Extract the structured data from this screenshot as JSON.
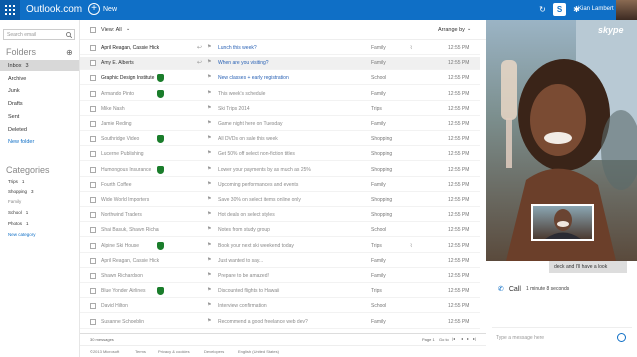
{
  "header": {
    "brand": "Outlook.com",
    "new_label": "New",
    "user_name": "Kian Lambert"
  },
  "sidebar": {
    "search_placeholder": "Search email",
    "folders_title": "Folders",
    "folders": [
      {
        "label": "Inbox",
        "count": "3"
      },
      {
        "label": "Archive",
        "count": ""
      },
      {
        "label": "Junk",
        "count": ""
      },
      {
        "label": "Drafts",
        "count": ""
      },
      {
        "label": "Sent",
        "count": ""
      },
      {
        "label": "Deleted",
        "count": ""
      }
    ],
    "new_folder": "New folder",
    "categories_title": "Categories",
    "categories": [
      {
        "label": "Trips",
        "count": "1"
      },
      {
        "label": "Shopping",
        "count": "3"
      },
      {
        "label": "Family",
        "count": ""
      },
      {
        "label": "School",
        "count": "1"
      },
      {
        "label": "Photos",
        "count": "1"
      }
    ],
    "new_category": "New category"
  },
  "list": {
    "view_label": "View: All",
    "arrange_label": "Arrange by",
    "rows": [
      {
        "sender": "April Reagan, Cassie Hicks",
        "subject": "Lunch this week?",
        "category": "Family",
        "date": "12:55 PM",
        "state": "unread"
      },
      {
        "sender": "Amy E. Alberts",
        "subject": "When are you visiting?",
        "category": "Family",
        "date": "12:55 PM",
        "state": "sel"
      },
      {
        "sender": "Graphic Design Institute",
        "subject": "New classes + early registration",
        "category": "School",
        "date": "12:55 PM",
        "state": "unread"
      },
      {
        "sender": "Armando Pinto",
        "subject": "This week's schedule",
        "category": "Family",
        "date": "12:55 PM",
        "state": "read"
      },
      {
        "sender": "Mike Nash",
        "subject": "Ski Trips 2014",
        "category": "Trips",
        "date": "12:55 PM",
        "state": "read"
      },
      {
        "sender": "Jamie Reding",
        "subject": "Game night here on Tuesday",
        "category": "Family",
        "date": "12:55 PM",
        "state": "read"
      },
      {
        "sender": "Southridge Video",
        "subject": "All DVDs on sale this week",
        "category": "Shopping",
        "date": "12:55 PM",
        "state": "read"
      },
      {
        "sender": "Lucerne Publishing",
        "subject": "Get 50% off select non-fiction titles",
        "category": "Shopping",
        "date": "12:55 PM",
        "state": "read"
      },
      {
        "sender": "Humongous Insurance",
        "subject": "Lower your payments by as much as 25%",
        "category": "Shopping",
        "date": "12:55 PM",
        "state": "read"
      },
      {
        "sender": "Fourth Coffee",
        "subject": "Upcoming performances and events",
        "category": "Family",
        "date": "12:55 PM",
        "state": "read"
      },
      {
        "sender": "Wide World Importers",
        "subject": "Save 30% on select items online only",
        "category": "Shopping",
        "date": "12:55 PM",
        "state": "read"
      },
      {
        "sender": "Northwind Traders",
        "subject": "Hot deals on select styles",
        "category": "Shopping",
        "date": "12:55 PM",
        "state": "read"
      },
      {
        "sender": "Shai Basuk, Shawn Richards...",
        "subject": "Notes from study group",
        "category": "School",
        "date": "12:55 PM",
        "state": "read"
      },
      {
        "sender": "Alpine Ski House",
        "subject": "Book your next ski weekend today",
        "category": "Trips",
        "date": "12:55 PM",
        "state": "read"
      },
      {
        "sender": "April Reagan, Cassie Hicks",
        "subject": "Just wanted to say...",
        "category": "Family",
        "date": "12:55 PM",
        "state": "read"
      },
      {
        "sender": "Shawn Richardson",
        "subject": "Prepare to be amazed!",
        "category": "Family",
        "date": "12:55 PM",
        "state": "read"
      },
      {
        "sender": "Blue Yonder Airlines",
        "subject": "Discounted flights to Hawaii",
        "category": "Trips",
        "date": "12:55 PM",
        "state": "read"
      },
      {
        "sender": "David Hilton",
        "subject": "Interview confirmation",
        "category": "School",
        "date": "12:55 PM",
        "state": "read"
      },
      {
        "sender": "Susanne Schoeblin",
        "subject": "Recommend a good freelance web dev?",
        "category": "Family",
        "date": "12:55 PM",
        "state": "read"
      }
    ],
    "message_count": "30 messages",
    "page_label": "Page 1",
    "goto_label": "Go to"
  },
  "footer": {
    "copyright": "©2013 Microsoft",
    "links": [
      "Terms",
      "Privacy & cookies",
      "Developers",
      "English (United States)"
    ]
  },
  "skype": {
    "logo": "skype",
    "bubble_text": "deck and I'll have a look",
    "call_label": "Call",
    "call_duration": "1 minute 8 seconds",
    "message_placeholder": "Type a message here"
  },
  "colors": {
    "topbar": "#0f6fc6",
    "accent": "#2a62b5",
    "shield": "#1a7d2b"
  }
}
